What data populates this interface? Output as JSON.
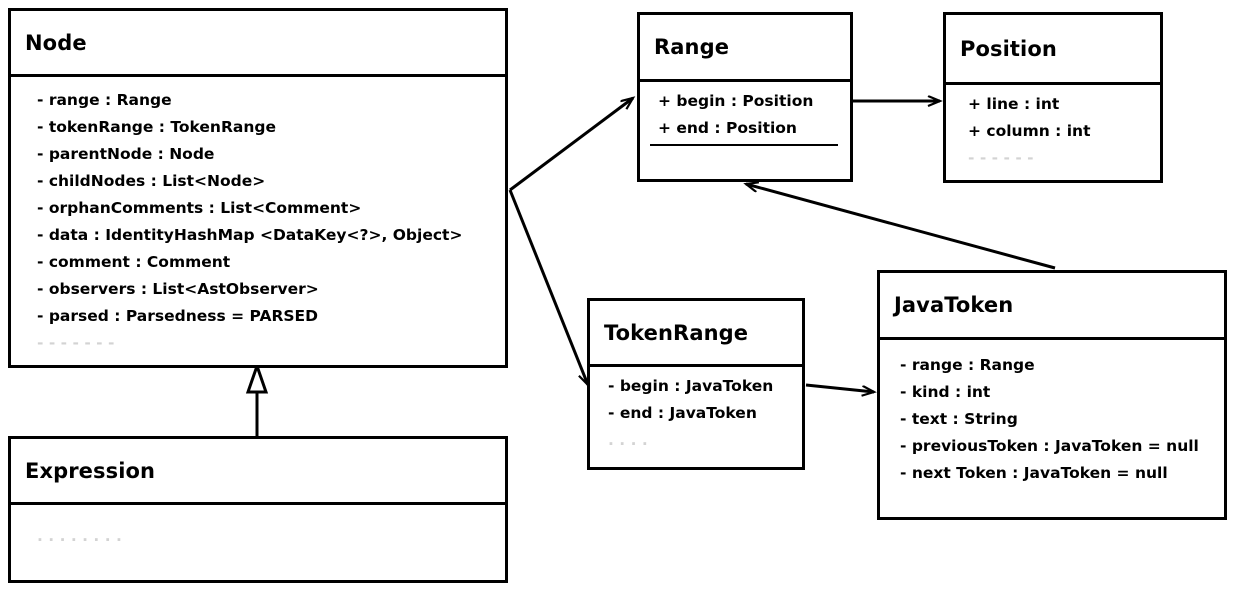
{
  "diagram": {
    "title": "UML class diagram",
    "line_color": "#000000",
    "background_color": "#ffffff"
  },
  "classes": [
    {
      "id": "node",
      "name": "Node",
      "attributes": [
        "- range : Range",
        "- tokenRange : TokenRange",
        "- parentNode : Node",
        "- childNodes : List<Node>",
        "- orphanComments : List<Comment>",
        "- data : IdentityHashMap <DataKey<?>, Object>",
        "- comment : Comment",
        "- observers : List<AstObserver>",
        "- parsed : Parsedness = PARSED"
      ],
      "ghost_attributes": [
        "- - - - - - -"
      ]
    },
    {
      "id": "range",
      "name": "Range",
      "attributes": [
        "+ begin : Position",
        "+ end : Position"
      ],
      "ghost_attributes": []
    },
    {
      "id": "position",
      "name": "Position",
      "attributes": [
        "+ line : int",
        "+ column : int"
      ],
      "ghost_attributes": [
        "- - - -  - -"
      ]
    },
    {
      "id": "tokenrange",
      "name": "TokenRange",
      "attributes": [
        "- begin : JavaToken",
        "- end : JavaToken"
      ],
      "ghost_attributes": [
        ". .  . ."
      ]
    },
    {
      "id": "javatoken",
      "name": "JavaToken",
      "attributes": [
        "- range : Range",
        "- kind : int",
        "- text : String",
        "- previousToken : JavaToken = null",
        "- next Token : JavaToken = null"
      ],
      "ghost_attributes": []
    },
    {
      "id": "expression",
      "name": "Expression",
      "attributes": [],
      "ghost_attributes": [
        ". .  .  .  .   .    .    ."
      ]
    }
  ],
  "relations": [
    {
      "id": "node-range",
      "from": "Node",
      "to": "Range",
      "type": "association"
    },
    {
      "id": "node-tokenrange",
      "from": "Node",
      "to": "TokenRange",
      "type": "association"
    },
    {
      "id": "range-position",
      "from": "Range",
      "to": "Position",
      "type": "association"
    },
    {
      "id": "javatoken-range",
      "from": "JavaToken",
      "to": "Range",
      "type": "association"
    },
    {
      "id": "tokenrange-javatoken",
      "from": "TokenRange",
      "to": "JavaToken",
      "type": "association"
    },
    {
      "id": "expression-node",
      "from": "Expression",
      "to": "Node",
      "type": "generalization"
    }
  ]
}
